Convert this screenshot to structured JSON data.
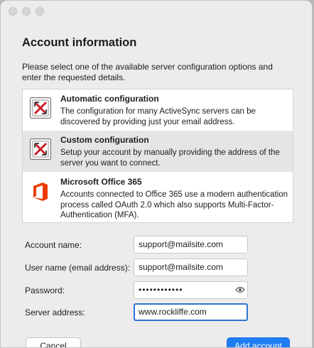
{
  "window": {
    "traffic_lights": [
      "close",
      "minimize",
      "zoom"
    ]
  },
  "heading": "Account information",
  "intro": "Please select one of the available server configuration options and enter the requested details.",
  "options": [
    {
      "title": "Automatic configuration",
      "description": "The configuration for many ActiveSync servers can be discovered by providing just your email address.",
      "icon": "exchange-icon",
      "selected": false
    },
    {
      "title": "Custom configuration",
      "description": "Setup your account by manually providing the address of the server you want to connect.",
      "icon": "exchange-icon",
      "selected": true
    },
    {
      "title": "Microsoft Office 365",
      "description": "Accounts connected to Office 365 use a modern authentication process called OAuth 2.0 which also supports Multi-Factor-Authentication (MFA).",
      "icon": "office-icon",
      "selected": false
    }
  ],
  "form": {
    "account_name": {
      "label": "Account name:",
      "value": "support@mailsite.com"
    },
    "user_name": {
      "label": "User name (email address):",
      "value": "support@mailsite.com"
    },
    "password": {
      "label": "Password:",
      "value": "••••••••••••"
    },
    "server_address": {
      "label": "Server address:",
      "value": "www.rockliffe.com"
    }
  },
  "buttons": {
    "cancel": "Cancel",
    "add_account": "Add account"
  },
  "colors": {
    "accent": "#1f7df5",
    "selected_row": "#e5e5e5",
    "office_orange": "#eb3c00",
    "exchange_red": "#c8202b"
  }
}
